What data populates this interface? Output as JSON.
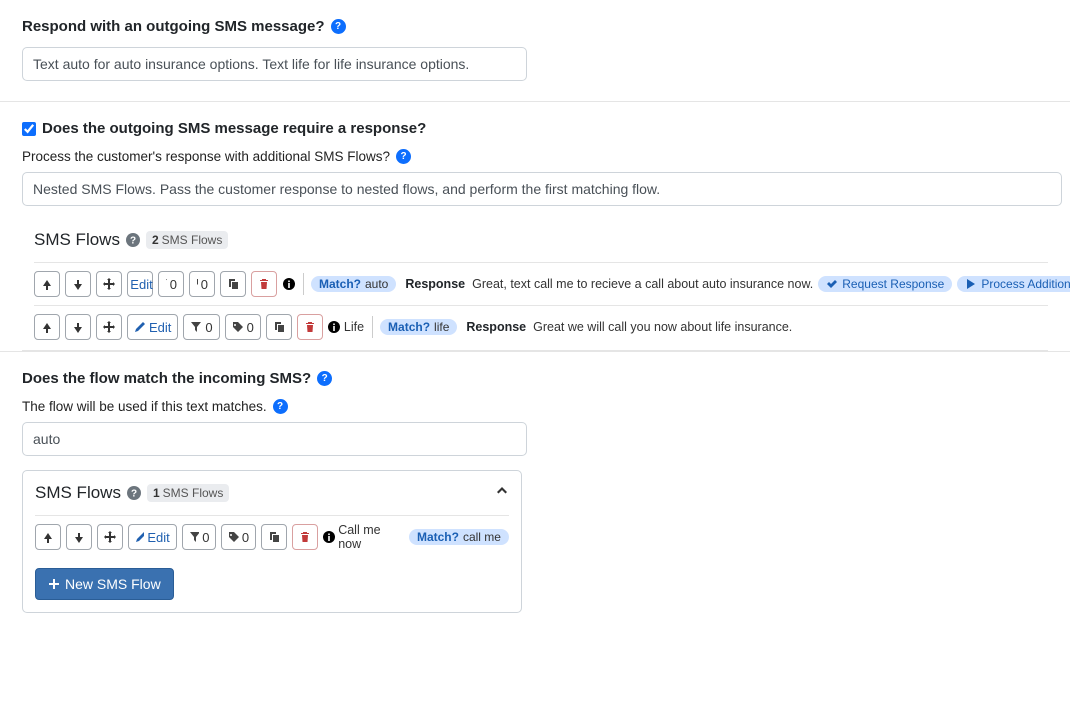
{
  "respond": {
    "heading": "Respond with an outgoing SMS message?",
    "value": "Text auto for auto insurance options. Text life for life insurance options."
  },
  "requireResponse": {
    "checked": true,
    "heading": "Does the outgoing SMS message require a response?",
    "subtext": "Process the customer's response with additional SMS Flows?",
    "nestedDesc": "Nested SMS Flows. Pass the customer response to nested flows, and perform the first matching flow."
  },
  "flowsTop": {
    "title": "SMS Flows",
    "count": "2",
    "countLabel": "SMS Flows",
    "rows": [
      {
        "editLabel": "Edit",
        "filterCount": "0",
        "tagCount": "0",
        "infoLabel": "",
        "matchPrefix": "Match?",
        "matchValue": "auto",
        "respLabel": "Response",
        "respText": "Great, text call me to recieve a call about auto insurance now.",
        "reqLabel": "Request Response",
        "procLabel": "Process Additional SMS Flows"
      },
      {
        "editLabel": "Edit",
        "filterCount": "0",
        "tagCount": "0",
        "infoLabel": "Life",
        "matchPrefix": "Match?",
        "matchValue": "life",
        "respLabel": "Response",
        "respText": "Great we will call you now about life insurance."
      }
    ]
  },
  "matchSection": {
    "heading": "Does the flow match the incoming SMS?",
    "subtext": "The flow will be used if this text matches.",
    "value": "auto"
  },
  "flowsBottom": {
    "title": "SMS Flows",
    "count": "1",
    "countLabel": "SMS Flows",
    "rows": [
      {
        "editLabel": "Edit",
        "filterCount": "0",
        "tagCount": "0",
        "infoLabel": "Call me now",
        "matchPrefix": "Match?",
        "matchValue": "call me"
      }
    ],
    "newFlowLabel": "New SMS Flow"
  }
}
